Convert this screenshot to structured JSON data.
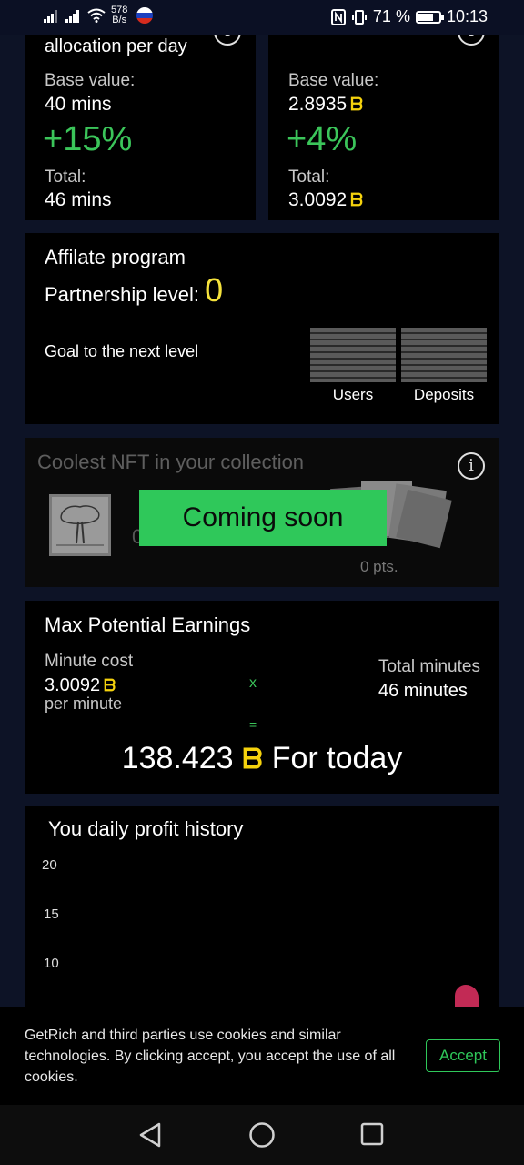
{
  "status_bar": {
    "net_speed_value": "578",
    "net_speed_unit": "B/s",
    "battery_percent": "71 %",
    "battery_level": 0.71,
    "time": "10:13"
  },
  "card_allocation": {
    "title": "allocation per day",
    "base_label": "Base value:",
    "base_value": "40 mins",
    "bonus": "+15%",
    "total_label": "Total:",
    "total_value": "46 mins"
  },
  "card_price": {
    "base_label": "Base value:",
    "base_value": "2.8935",
    "bonus": "+4%",
    "total_label": "Total:",
    "total_value": "3.0092"
  },
  "affiliate": {
    "title": "Affilate program",
    "partnership_label": "Partnership level:",
    "partnership_value": "0",
    "goal_label": "Goal to the next level",
    "users_label": "Users",
    "deposits_label": "Deposits"
  },
  "nft": {
    "title": "Coolest NFT in your collection",
    "points": "0  pts.",
    "coming_soon": "Coming soon",
    "hidden_digit": "0"
  },
  "earnings": {
    "title": "Max Potential Earnings",
    "minute_cost_label": "Minute cost",
    "minute_cost_value": "3.0092",
    "per_minute": "per minute",
    "multiply": "x",
    "equals": "=",
    "total_minutes_label": "Total minutes",
    "total_minutes_value": "46 minutes",
    "result_value": "138.423",
    "result_suffix": "For today"
  },
  "history": {
    "title": "You daily profit history"
  },
  "chart_data": {
    "type": "bar",
    "y_ticks": [
      "20",
      "15",
      "10"
    ]
  },
  "cookie": {
    "text": "GetRich and third parties use cookies and similar technologies. By clicking accept, you accept the use of all cookies.",
    "accept_label": "Accept"
  },
  "colors": {
    "accent_green": "#2fc85a",
    "bonus_green": "#3bc55a",
    "coin_yellow": "#f5d20d",
    "card_bg": "#000000",
    "page_bg": "#0d1326"
  }
}
